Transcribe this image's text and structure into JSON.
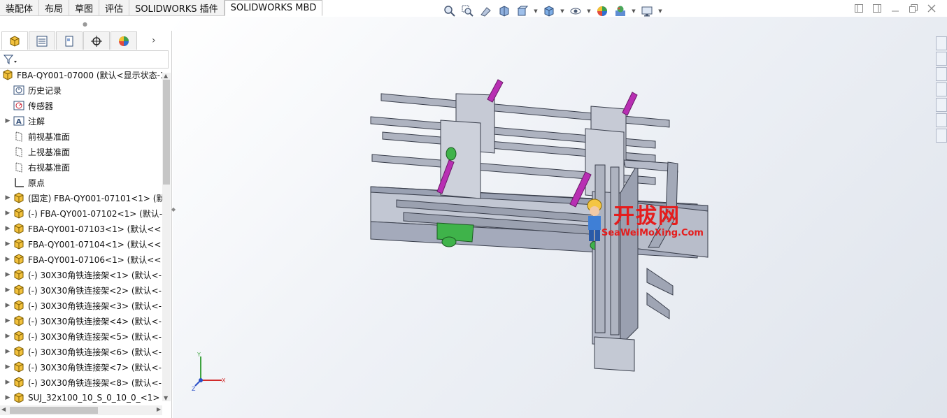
{
  "tabs": [
    {
      "label": "装配体",
      "active": false
    },
    {
      "label": "布局",
      "active": false
    },
    {
      "label": "草图",
      "active": false
    },
    {
      "label": "评估",
      "active": false
    },
    {
      "label": "SOLIDWORKS 插件",
      "active": false
    },
    {
      "label": "SOLIDWORKS MBD",
      "active": true
    }
  ],
  "toolbar_icons": [
    "zoom-to-fit-icon",
    "zoom-area-icon",
    "previous-view-icon",
    "section-view-icon",
    "view-orientation-icon",
    "display-style-icon",
    "hide-show-icon",
    "edit-appearance-icon",
    "apply-scene-icon",
    "view-settings-icon"
  ],
  "panel_tabs": [
    "feature-manager-icon",
    "property-manager-icon",
    "configuration-manager-icon",
    "dimxpert-icon",
    "display-manager-icon"
  ],
  "tree": {
    "root": "FBA-QY001-07000  (默认<显示状态-1",
    "items": [
      {
        "label": "历史记录",
        "icon": "history-icon",
        "expandable": false
      },
      {
        "label": "传感器",
        "icon": "sensor-icon",
        "expandable": false
      },
      {
        "label": "注解",
        "icon": "annotation-icon",
        "expandable": true
      },
      {
        "label": "前视基准面",
        "icon": "plane-icon",
        "expandable": false
      },
      {
        "label": "上视基准面",
        "icon": "plane-icon",
        "expandable": false
      },
      {
        "label": "右视基准面",
        "icon": "plane-icon",
        "expandable": false
      },
      {
        "label": "原点",
        "icon": "origin-icon",
        "expandable": false
      },
      {
        "label": "(固定) FBA-QY001-07101<1> (默",
        "icon": "subassembly-icon",
        "expandable": true
      },
      {
        "label": "(-) FBA-QY001-07102<1> (默认-",
        "icon": "subassembly-icon",
        "expandable": true
      },
      {
        "label": "FBA-QY001-07103<1> (默认<<",
        "icon": "subassembly-icon",
        "expandable": true
      },
      {
        "label": "FBA-QY001-07104<1> (默认<<",
        "icon": "subassembly-icon",
        "expandable": true
      },
      {
        "label": "FBA-QY001-07106<1> (默认<<",
        "icon": "subassembly-icon",
        "expandable": true
      },
      {
        "label": "(-) 30X30角铁连接架<1> (默认<-",
        "icon": "subassembly-icon",
        "expandable": true
      },
      {
        "label": "(-) 30X30角铁连接架<2> (默认<-",
        "icon": "subassembly-icon",
        "expandable": true
      },
      {
        "label": "(-) 30X30角铁连接架<3> (默认<-",
        "icon": "subassembly-icon",
        "expandable": true
      },
      {
        "label": "(-) 30X30角铁连接架<4> (默认<-",
        "icon": "subassembly-icon",
        "expandable": true
      },
      {
        "label": "(-) 30X30角铁连接架<5> (默认<-",
        "icon": "subassembly-icon",
        "expandable": true
      },
      {
        "label": "(-) 30X30角铁连接架<6> (默认<-",
        "icon": "subassembly-icon",
        "expandable": true
      },
      {
        "label": "(-) 30X30角铁连接架<7> (默认<-",
        "icon": "subassembly-icon",
        "expandable": true
      },
      {
        "label": "(-) 30X30角铁连接架<8> (默认<-",
        "icon": "subassembly-icon",
        "expandable": true
      },
      {
        "label": "SUJ_32x100_10_S_0_10_0_<1> (S",
        "icon": "subassembly-icon",
        "expandable": true
      }
    ]
  },
  "watermark": {
    "title": "开拔网",
    "url": "SeaWeiMoXing.Com"
  },
  "triad": {
    "x": "X",
    "y": "Y",
    "z": "Z"
  },
  "colors": {
    "accent": "#2b5797",
    "model_gray": "#a9afbd",
    "rod_magenta": "#b82fb3",
    "part_green": "#3fb34a",
    "watermark_red": "#e51d1d"
  }
}
